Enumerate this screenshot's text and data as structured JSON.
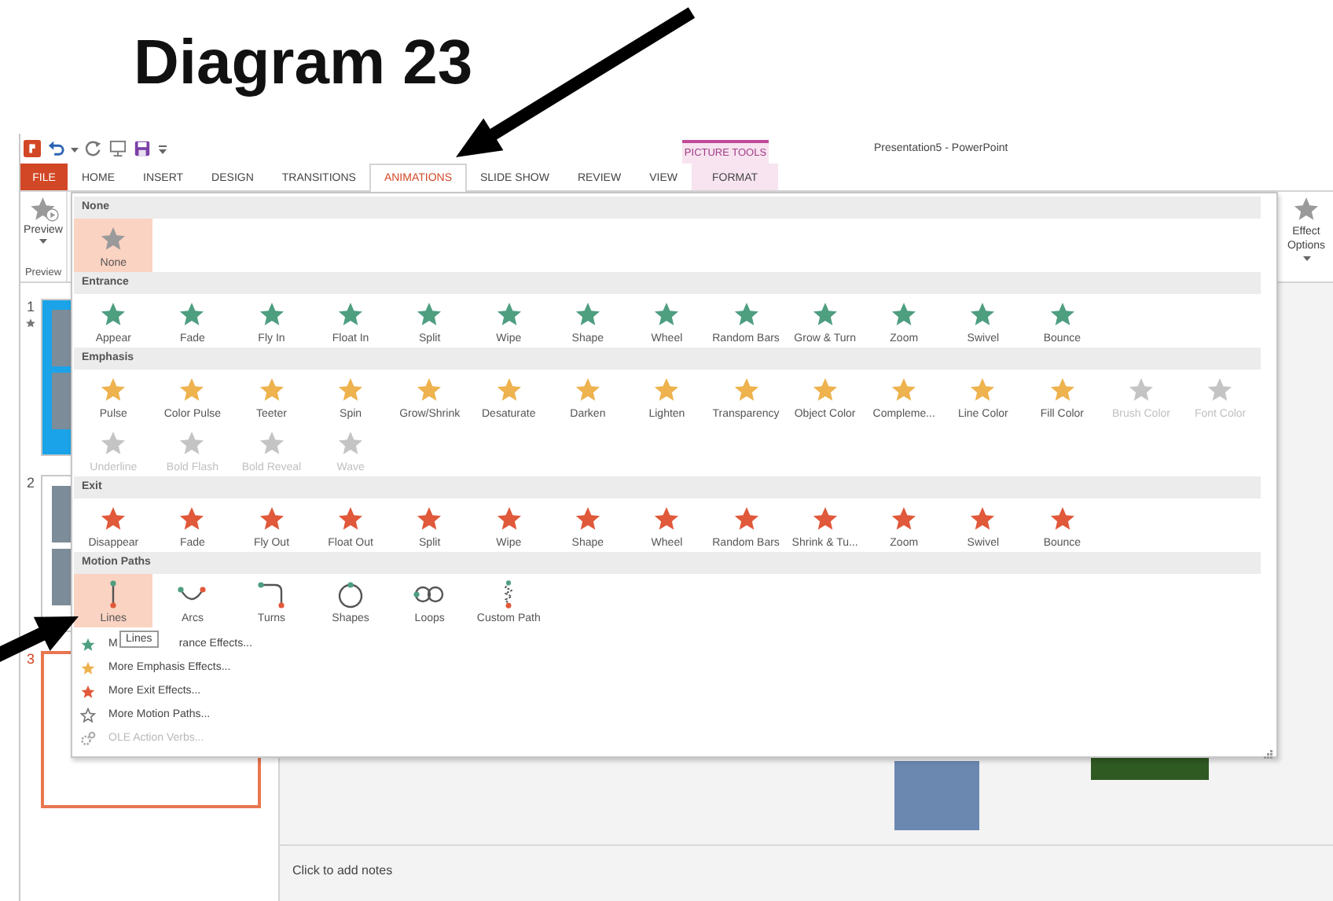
{
  "heading": "Diagram 23",
  "title_bar": {
    "contextual_group": "PICTURE TOOLS",
    "title": "Presentation5 - PowerPoint"
  },
  "tabs": [
    {
      "label": "FILE",
      "kind": "file",
      "selected": false
    },
    {
      "label": "HOME",
      "kind": "normal",
      "selected": false
    },
    {
      "label": "INSERT",
      "kind": "normal",
      "selected": false
    },
    {
      "label": "DESIGN",
      "kind": "normal",
      "selected": false
    },
    {
      "label": "TRANSITIONS",
      "kind": "normal",
      "selected": false
    },
    {
      "label": "ANIMATIONS",
      "kind": "normal",
      "selected": true
    },
    {
      "label": "SLIDE SHOW",
      "kind": "normal",
      "selected": false
    },
    {
      "label": "REVIEW",
      "kind": "normal",
      "selected": false
    },
    {
      "label": "VIEW",
      "kind": "normal",
      "selected": false
    },
    {
      "label": "FORMAT",
      "kind": "contextual",
      "selected": false
    }
  ],
  "ribbon": {
    "preview": {
      "label": "Preview",
      "group": "Preview"
    },
    "effect_options": {
      "label": "Effect Options"
    }
  },
  "slides": [
    {
      "number": "1",
      "kind": "photos",
      "animated": true,
      "selected": false
    },
    {
      "number": "2",
      "kind": "photos",
      "animated": false,
      "selected": false
    },
    {
      "number": "3",
      "kind": "blank",
      "animated": false,
      "selected": true
    }
  ],
  "notes": {
    "placeholder": "Click to add notes"
  },
  "gallery": {
    "sections": [
      {
        "title": "None",
        "kind": "none",
        "items": [
          {
            "label": "None",
            "selected": true,
            "disabled": false
          }
        ]
      },
      {
        "title": "Entrance",
        "kind": "entrance",
        "items": [
          {
            "label": "Appear",
            "selected": false,
            "disabled": false
          },
          {
            "label": "Fade",
            "selected": false,
            "disabled": false
          },
          {
            "label": "Fly In",
            "selected": false,
            "disabled": false
          },
          {
            "label": "Float In",
            "selected": false,
            "disabled": false
          },
          {
            "label": "Split",
            "selected": false,
            "disabled": false
          },
          {
            "label": "Wipe",
            "selected": false,
            "disabled": false
          },
          {
            "label": "Shape",
            "selected": false,
            "disabled": false
          },
          {
            "label": "Wheel",
            "selected": false,
            "disabled": false
          },
          {
            "label": "Random Bars",
            "selected": false,
            "disabled": false
          },
          {
            "label": "Grow & Turn",
            "selected": false,
            "disabled": false
          },
          {
            "label": "Zoom",
            "selected": false,
            "disabled": false
          },
          {
            "label": "Swivel",
            "selected": false,
            "disabled": false
          },
          {
            "label": "Bounce",
            "selected": false,
            "disabled": false
          }
        ]
      },
      {
        "title": "Emphasis",
        "kind": "emphasis",
        "items": [
          {
            "label": "Pulse",
            "selected": false,
            "disabled": false
          },
          {
            "label": "Color Pulse",
            "selected": false,
            "disabled": false
          },
          {
            "label": "Teeter",
            "selected": false,
            "disabled": false
          },
          {
            "label": "Spin",
            "selected": false,
            "disabled": false
          },
          {
            "label": "Grow/Shrink",
            "selected": false,
            "disabled": false
          },
          {
            "label": "Desaturate",
            "selected": false,
            "disabled": false
          },
          {
            "label": "Darken",
            "selected": false,
            "disabled": false
          },
          {
            "label": "Lighten",
            "selected": false,
            "disabled": false
          },
          {
            "label": "Transparency",
            "selected": false,
            "disabled": false
          },
          {
            "label": "Object Color",
            "selected": false,
            "disabled": false
          },
          {
            "label": "Compleme...",
            "selected": false,
            "disabled": false
          },
          {
            "label": "Line Color",
            "selected": false,
            "disabled": false
          },
          {
            "label": "Fill Color",
            "selected": false,
            "disabled": false
          },
          {
            "label": "Brush Color",
            "selected": false,
            "disabled": true
          },
          {
            "label": "Font Color",
            "selected": false,
            "disabled": true
          },
          {
            "label": "Underline",
            "selected": false,
            "disabled": true
          },
          {
            "label": "Bold Flash",
            "selected": false,
            "disabled": true
          },
          {
            "label": "Bold Reveal",
            "selected": false,
            "disabled": true
          },
          {
            "label": "Wave",
            "selected": false,
            "disabled": true
          }
        ]
      },
      {
        "title": "Exit",
        "kind": "exit",
        "items": [
          {
            "label": "Disappear",
            "selected": false,
            "disabled": false
          },
          {
            "label": "Fade",
            "selected": false,
            "disabled": false
          },
          {
            "label": "Fly Out",
            "selected": false,
            "disabled": false
          },
          {
            "label": "Float Out",
            "selected": false,
            "disabled": false
          },
          {
            "label": "Split",
            "selected": false,
            "disabled": false
          },
          {
            "label": "Wipe",
            "selected": false,
            "disabled": false
          },
          {
            "label": "Shape",
            "selected": false,
            "disabled": false
          },
          {
            "label": "Wheel",
            "selected": false,
            "disabled": false
          },
          {
            "label": "Random Bars",
            "selected": false,
            "disabled": false
          },
          {
            "label": "Shrink & Tu...",
            "selected": false,
            "disabled": false
          },
          {
            "label": "Zoom",
            "selected": false,
            "disabled": false
          },
          {
            "label": "Swivel",
            "selected": false,
            "disabled": false
          },
          {
            "label": "Bounce",
            "selected": false,
            "disabled": false
          }
        ]
      },
      {
        "title": "Motion Paths",
        "kind": "path",
        "items": [
          {
            "label": "Lines",
            "kind": "line",
            "selected": true,
            "disabled": false
          },
          {
            "label": "Arcs",
            "kind": "arc",
            "selected": false,
            "disabled": false
          },
          {
            "label": "Turns",
            "kind": "turn",
            "selected": false,
            "disabled": false
          },
          {
            "label": "Shapes",
            "kind": "shape",
            "selected": false,
            "disabled": false
          },
          {
            "label": "Loops",
            "kind": "loop",
            "selected": false,
            "disabled": false
          },
          {
            "label": "Custom Path",
            "kind": "custom",
            "selected": false,
            "disabled": false
          }
        ]
      }
    ],
    "menu": [
      {
        "label_parts": [
          "M",
          "rance Effects..."
        ],
        "kind": "entrance",
        "disabled": false
      },
      {
        "label": "More Emphasis Effects...",
        "kind": "emphasis",
        "disabled": false
      },
      {
        "label": "More Exit Effects...",
        "kind": "exit",
        "disabled": false
      },
      {
        "label": "More Motion Paths...",
        "kind": "path",
        "disabled": false
      },
      {
        "label": "OLE Action Verbs...",
        "kind": "ole",
        "disabled": true
      }
    ],
    "tooltip": "Lines"
  }
}
